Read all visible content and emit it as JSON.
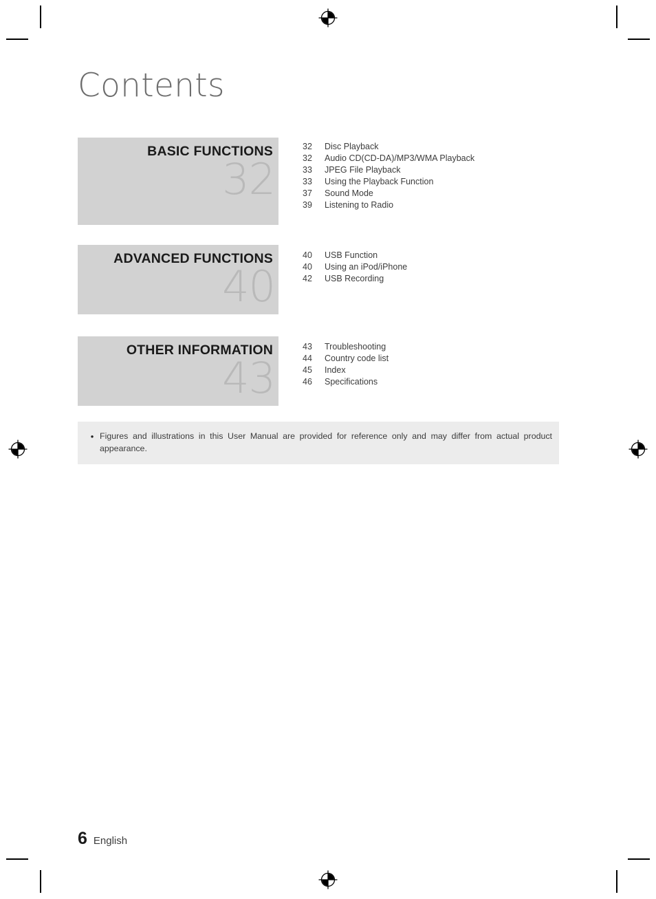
{
  "page": {
    "title": "Contents",
    "footer_page_number": "6",
    "footer_language": "English"
  },
  "colors": {
    "section_block_bg": "#d2d2d2",
    "section_block_number": "#b9b9b9",
    "section_block_title": "#1a1a1a",
    "note_box_bg": "#ececec",
    "body_text": "#3c3c3c",
    "title_text": "#6d6d6d",
    "crop_mark": "#000000"
  },
  "toc": {
    "sections": [
      {
        "title": "BASIC FUNCTIONS",
        "start_page": "32",
        "entries": [
          {
            "page": "32",
            "title": "Disc Playback"
          },
          {
            "page": "32",
            "title": "Audio CD(CD-DA)/MP3/WMA Playback"
          },
          {
            "page": "33",
            "title": "JPEG File Playback"
          },
          {
            "page": "33",
            "title": "Using the Playback Function"
          },
          {
            "page": "37",
            "title": "Sound Mode"
          },
          {
            "page": "39",
            "title": "Listening to Radio"
          }
        ]
      },
      {
        "title": "ADVANCED FUNCTIONS",
        "start_page": "40",
        "entries": [
          {
            "page": "40",
            "title": "USB Function"
          },
          {
            "page": "40",
            "title": "Using an iPod/iPhone"
          },
          {
            "page": "42",
            "title": "USB Recording"
          }
        ]
      },
      {
        "title": "OTHER INFORMATION",
        "start_page": "43",
        "entries": [
          {
            "page": "43",
            "title": "Troubleshooting"
          },
          {
            "page": "44",
            "title": "Country code list"
          },
          {
            "page": "45",
            "title": "Index"
          },
          {
            "page": "46",
            "title": "Specifications"
          }
        ]
      }
    ]
  },
  "note": {
    "bullet": "•",
    "text": "Figures and illustrations in this User Manual are provided for reference only and may differ from actual product appearance."
  }
}
